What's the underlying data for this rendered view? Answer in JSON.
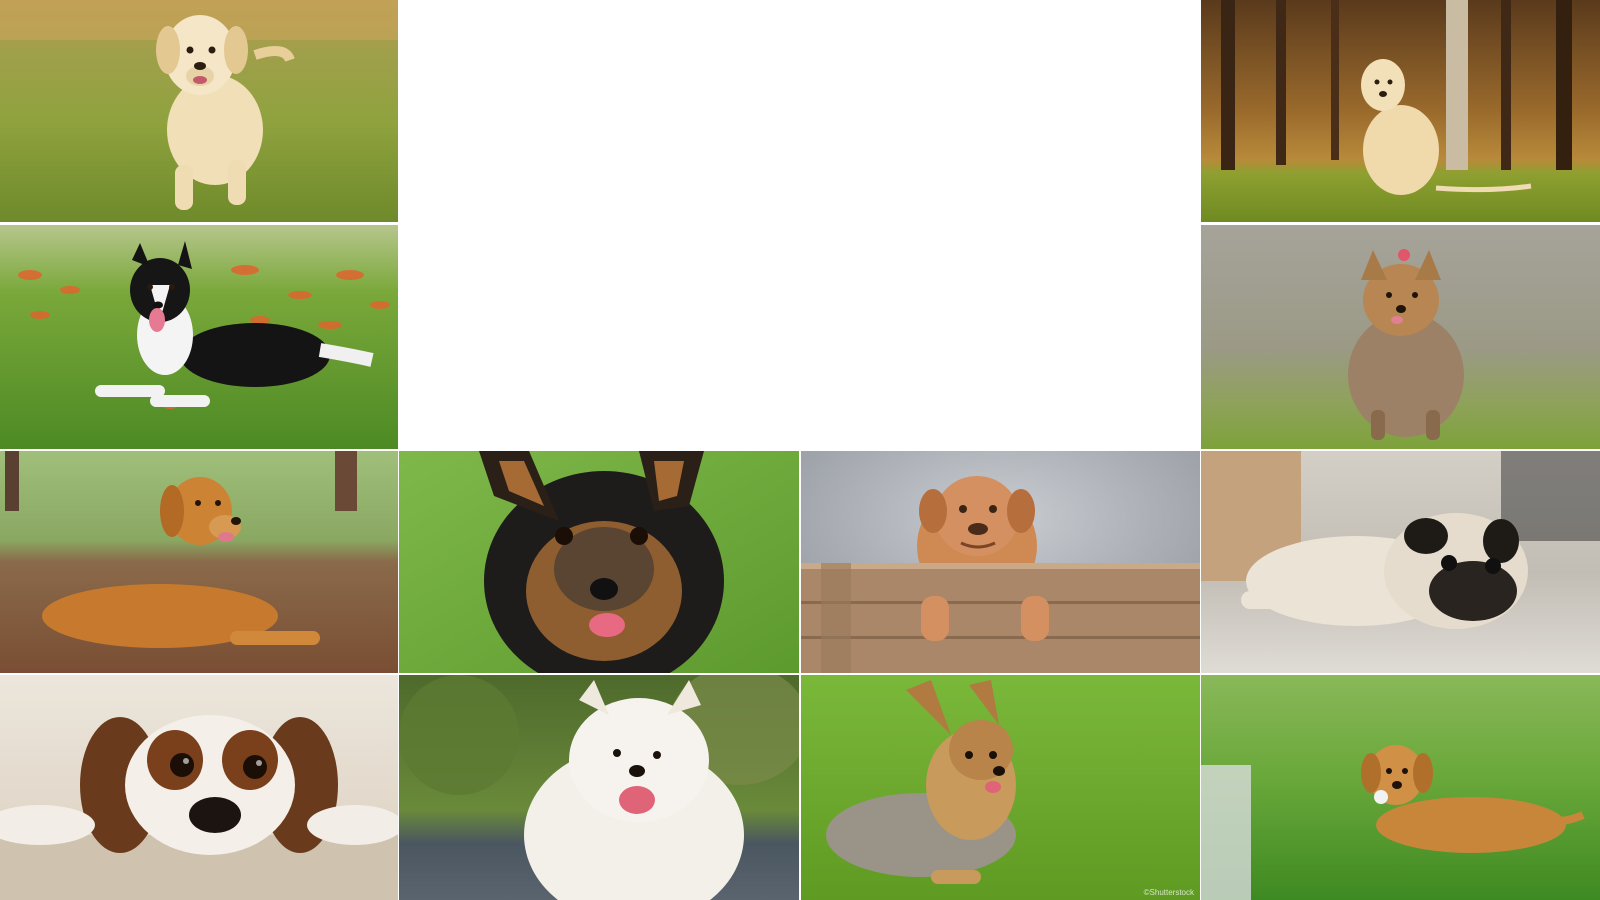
{
  "gallery": {
    "background": "#ffffff",
    "tiles": [
      {
        "subject": "golden-retriever-puppy-running",
        "setting": "grass"
      },
      {
        "subject": "golden-retriever-sitting",
        "setting": "autumn-forest"
      },
      {
        "subject": "border-collie-lying",
        "setting": "grass-with-autumn-leaves"
      },
      {
        "subject": "yorkshire-terrier-with-bow",
        "setting": "blurred-field"
      },
      {
        "subject": "golden-retriever-lying",
        "setting": "dirt-path"
      },
      {
        "subject": "yorkshire-terrier-face",
        "setting": "green-grass"
      },
      {
        "subject": "dogue-de-bordeaux-puppy-in-crate",
        "setting": "grey-studio"
      },
      {
        "subject": "pug-lying",
        "setting": "indoor-floor"
      },
      {
        "subject": "cavalier-king-charles-spaniel-lying",
        "setting": "carpet"
      },
      {
        "subject": "samoyed-smiling",
        "setting": "garden"
      },
      {
        "subject": "yorkshire-terrier-lying",
        "setting": "grass"
      },
      {
        "subject": "golden-retriever-puppy-lying-with-toy",
        "setting": "lawn"
      }
    ],
    "watermark": "©Shutterstock"
  }
}
